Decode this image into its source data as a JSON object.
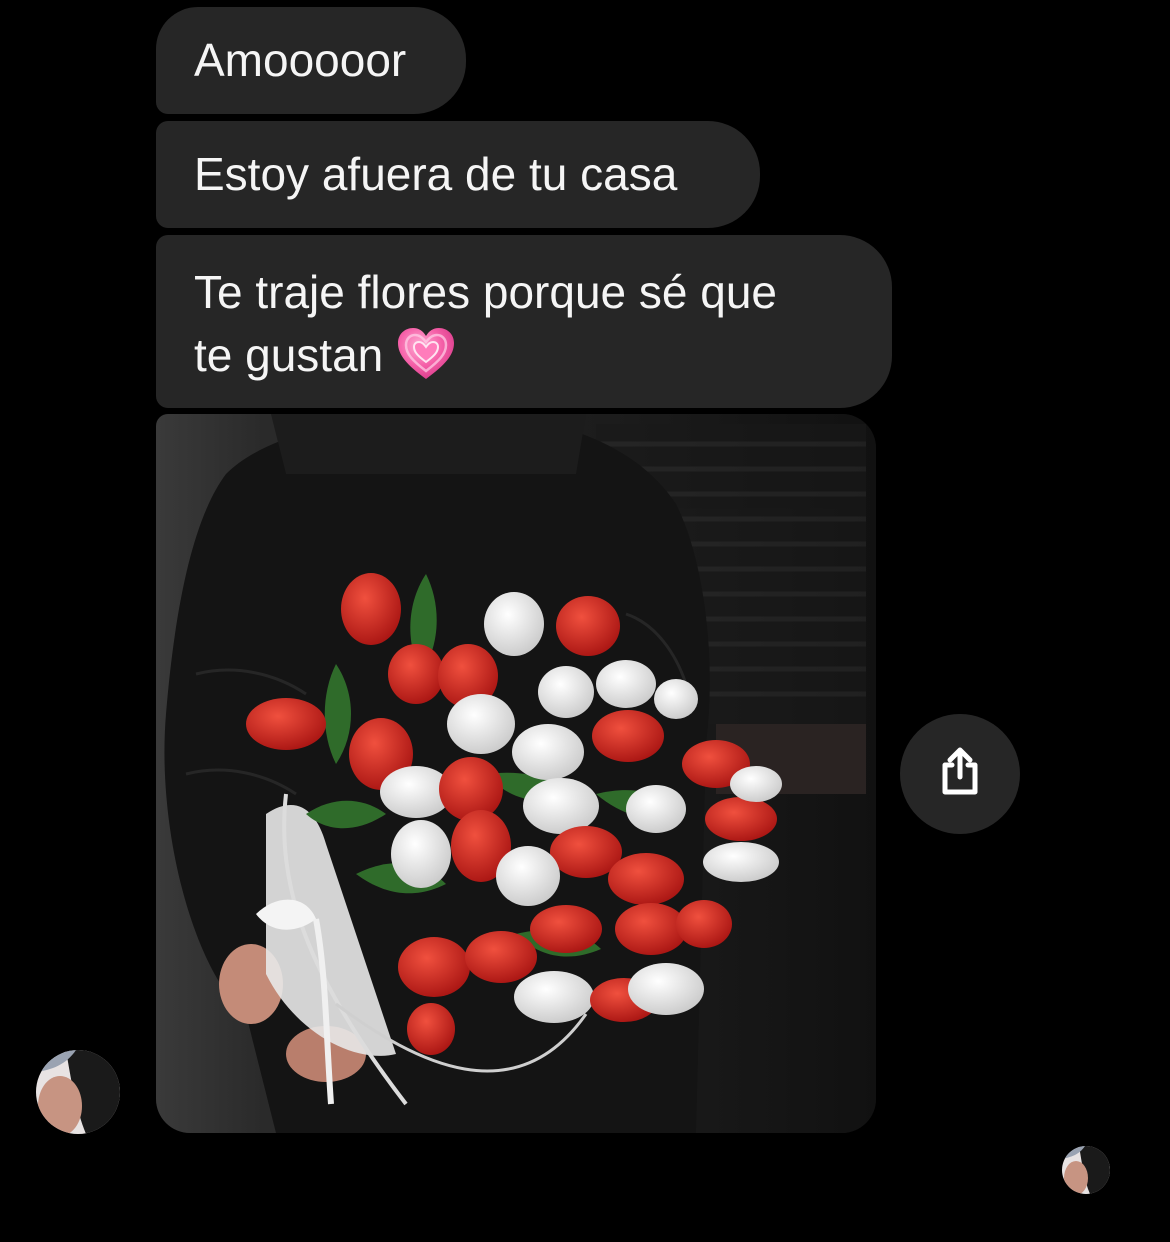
{
  "messages": [
    {
      "text": "Amooooor"
    },
    {
      "text": "Estoy afuera de tu casa"
    },
    {
      "line1": "Te traje flores porque sé que",
      "line2": "te gustan",
      "emoji": "growing-heart"
    }
  ],
  "photo": {
    "subject": "bouquet-of-red-and-white-tulips"
  },
  "share_button": {
    "icon": "share-icon"
  },
  "colors": {
    "background": "#000000",
    "bubble": "#262626",
    "text": "#f5f5f5"
  }
}
